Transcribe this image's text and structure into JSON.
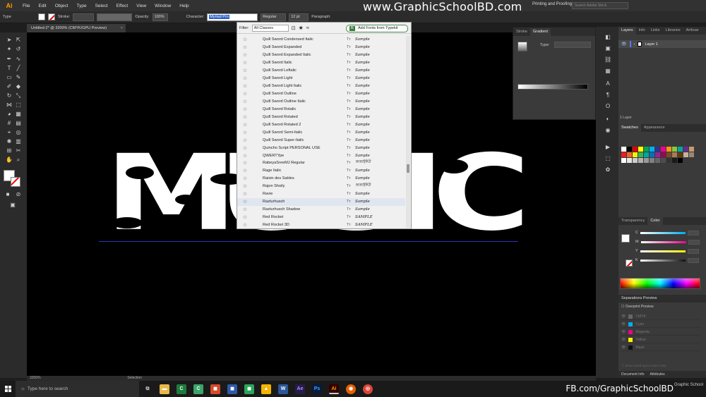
{
  "app": {
    "logo": "Ai"
  },
  "menu": [
    "File",
    "Edit",
    "Object",
    "Type",
    "Select",
    "Effect",
    "View",
    "Window",
    "Help"
  ],
  "control_bar": {
    "type_label": "Type",
    "stroke_label": "Stroke:",
    "opacity_label": "Opacity:",
    "opacity_value": "100%",
    "character_label": "Character:",
    "font_value": "Myriad Pro",
    "style_value": "Regular",
    "size_value": "12 pt",
    "paragraph_label": "Paragraph:"
  },
  "watermark_top": "www.GraphicSchoolBD.com",
  "workspace": "Printing and Proofing",
  "search_placeholder": "Search Adobe Stock",
  "document_tab": {
    "title": "Untitled-2* @ 3200% (CMYK/GPU Preview)",
    "close": "×"
  },
  "canvas": {
    "artwork_text": [
      "M",
      "U",
      "S",
      "I",
      "C"
    ]
  },
  "font_popup": {
    "filter_label": "Filter:",
    "filter_value": "All Classes",
    "typekit_label": "Add Fonts from Typekit",
    "typekit_icon": "tk",
    "fonts": [
      {
        "name": "Quill Sword Condensed Italic",
        "sample": "Sample"
      },
      {
        "name": "Quill Sword Expanded",
        "sample": "Sample"
      },
      {
        "name": "Quill Sword Expanded Italic",
        "sample": "Sample"
      },
      {
        "name": "Quill Sword Italic",
        "sample": "Sample"
      },
      {
        "name": "Quill Sword Leftalic",
        "sample": "Sample"
      },
      {
        "name": "Quill Sword Light",
        "sample": "Sample"
      },
      {
        "name": "Quill Sword Light Italic",
        "sample": "Sample"
      },
      {
        "name": "Quill Sword Outline",
        "sample": "Sample"
      },
      {
        "name": "Quill Sword Outline Italic",
        "sample": "Sample"
      },
      {
        "name": "Quill Sword Rotalic",
        "sample": "Sample"
      },
      {
        "name": "Quill Sword Rotated",
        "sample": "Sample"
      },
      {
        "name": "Quill Sword Rotated 2",
        "sample": "Sample"
      },
      {
        "name": "Quill Sword Semi-Italic",
        "sample": "Sample"
      },
      {
        "name": "Quill Sword Super-Italic",
        "sample": "Sample"
      },
      {
        "name": "Quincho Script PERSONAL USE",
        "sample": "Sample"
      },
      {
        "name": "QWERTYpe",
        "sample": "Sample"
      },
      {
        "name": "RabeyaSreeMJ Regular",
        "sample": "অআইঈউ"
      },
      {
        "name": "Rage Italic",
        "sample": "Sample"
      },
      {
        "name": "Raisin des Sables",
        "sample": "Sample"
      },
      {
        "name": "Rajon Shoily",
        "sample": "অআইঈউ"
      },
      {
        "name": "Ravie",
        "sample": "Sample"
      },
      {
        "name": "Razturhusch",
        "sample": "Sample"
      },
      {
        "name": "Razturhusch Shadow",
        "sample": "Sample"
      },
      {
        "name": "Red Rocket",
        "sample": "SAMPLE"
      },
      {
        "name": "Red Rocket 3D",
        "sample": "SAMPLE"
      }
    ]
  },
  "gradient_panel": {
    "tab_stroke": "Stroke",
    "tab_gradient": "Gradient",
    "type_label": "Type:"
  },
  "layers_panel": {
    "tabs": [
      "Layers",
      "Info",
      "Links",
      "Libraries",
      "Artboar"
    ],
    "layer_name": "Layer 1",
    "count": "1 Layer"
  },
  "swatches_panel": {
    "tabs": [
      "Swatches",
      "Appearance"
    ]
  },
  "color_panel": {
    "tabs": [
      "Transparency",
      "Color"
    ],
    "channels": [
      {
        "label": "C",
        "value": "",
        "color": "#00aeef"
      },
      {
        "label": "M",
        "value": "",
        "color": "#ec008c"
      },
      {
        "label": "Y",
        "value": "",
        "color": "#fff200"
      },
      {
        "label": "K",
        "value": "",
        "color": "#111111"
      }
    ]
  },
  "separations_panel": {
    "title": "Separations Preview",
    "overprint": "Overprint Preview",
    "rows": [
      {
        "name": "CMYK",
        "color": "#666"
      },
      {
        "name": "Cyan",
        "color": "#00aeef"
      },
      {
        "name": "Magenta",
        "color": "#ec008c"
      },
      {
        "name": "Yellow",
        "color": "#fff200"
      },
      {
        "name": "Black",
        "color": "#111"
      }
    ],
    "footer": "Show Used Spot Colors Only"
  },
  "bottom_tabs": [
    "Document Info",
    "Attributes"
  ],
  "status_bar": {
    "zoom": "3200%",
    "mode": "Selection"
  },
  "taskbar": {
    "search_placeholder": "Type here to search"
  },
  "watermark_bottom": "FB.com/GraphicSchoolBD",
  "logo_bottom": "Graphic School"
}
